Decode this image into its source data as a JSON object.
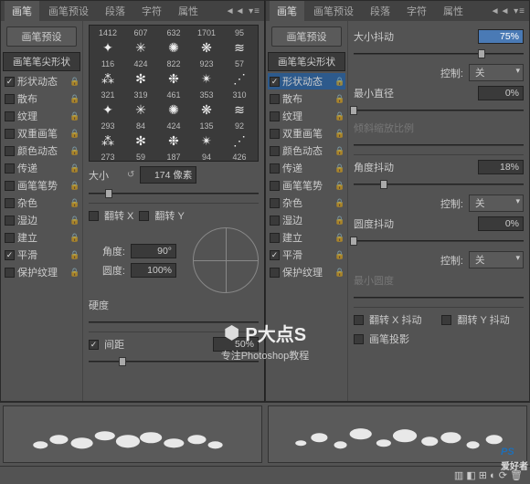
{
  "tabs": {
    "brush": "画笔",
    "preset": "画笔预设",
    "para": "段落",
    "char": "字符",
    "attr": "属性",
    "ctrl": "◄◄ ▾≡"
  },
  "sidebar": {
    "preset_btn": "画笔预设",
    "tip": "画笔笔尖形状",
    "items": [
      {
        "label": "形状动态",
        "chk": true
      },
      {
        "label": "散布",
        "chk": false
      },
      {
        "label": "纹理",
        "chk": false
      },
      {
        "label": "双重画笔",
        "chk": false
      },
      {
        "label": "颜色动态",
        "chk": false
      },
      {
        "label": "传递",
        "chk": false
      },
      {
        "label": "画笔笔势",
        "chk": false
      },
      {
        "label": "杂色",
        "chk": false
      },
      {
        "label": "湿边",
        "chk": false
      },
      {
        "label": "建立",
        "chk": false
      },
      {
        "label": "平滑",
        "chk": true
      },
      {
        "label": "保护纹理",
        "chk": false
      }
    ]
  },
  "brushes": [
    [
      "1412",
      "607",
      "632",
      "1701",
      "95"
    ],
    [
      "116",
      "424",
      "822",
      "923",
      "57"
    ],
    [
      "321",
      "319",
      "461",
      "353",
      "310"
    ],
    [
      "293",
      "84",
      "424",
      "135",
      "92"
    ],
    [
      "273",
      "59",
      "187",
      "94",
      "426"
    ]
  ],
  "left": {
    "size_lbl": "大小",
    "size_val": "174 像素",
    "flipx": "翻转 X",
    "flipy": "翻转 Y",
    "angle_lbl": "角度:",
    "angle_val": "90°",
    "round_lbl": "圆度:",
    "round_val": "100%",
    "hard_lbl": "硬度",
    "spacing_lbl": "间距",
    "spacing_val": "50%"
  },
  "right": {
    "title": "大小抖动",
    "title_val": "75%",
    "ctrl_lbl": "控制:",
    "ctrl_val": "关",
    "mindia_lbl": "最小直径",
    "mindia_val": "0%",
    "tilt_lbl": "倾斜缩放比例",
    "angj_lbl": "角度抖动",
    "angj_val": "18%",
    "rndj_lbl": "圆度抖动",
    "rndj_val": "0%",
    "minr_lbl": "最小圆度",
    "flipxj": "翻转 X 抖动",
    "flipyj": "翻转 Y 抖动",
    "proj": "画笔投影"
  },
  "wm": {
    "title": "P大点S",
    "sub": "专注Photoshop教程"
  },
  "corner": {
    "p": "PS",
    "z": "爱好者"
  },
  "footer_icons": "▥  ◧  ⊞  ◐  ⟳  🗑"
}
